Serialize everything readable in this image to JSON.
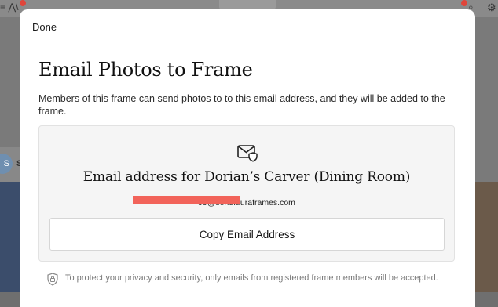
{
  "background": {
    "top_left_text": "≡ ⋀\\",
    "avatar_letter": "S",
    "side_letter": "S",
    "gear_glyph": "⚙",
    "search_glyph": "⌕",
    "accent_dot_color": "#e0453a"
  },
  "modal": {
    "done_label": "Done",
    "title": "Email Photos to Frame",
    "description": "Members of this frame can send photos to to this email address, and they will be added to the frame.",
    "card": {
      "icon": "mail-shield-icon",
      "title": "Email address for Dorian’s Carver (Dining Room)",
      "email_visible": "99@send.auraframes.com",
      "copy_button_label": "Copy Email Address"
    },
    "privacy_icon": "lock-shield-icon",
    "privacy_text": "To protect your privacy and security, only emails from registered frame members will be accepted."
  },
  "colors": {
    "redaction": "#f2635a",
    "card_bg": "#f5f5f5"
  }
}
